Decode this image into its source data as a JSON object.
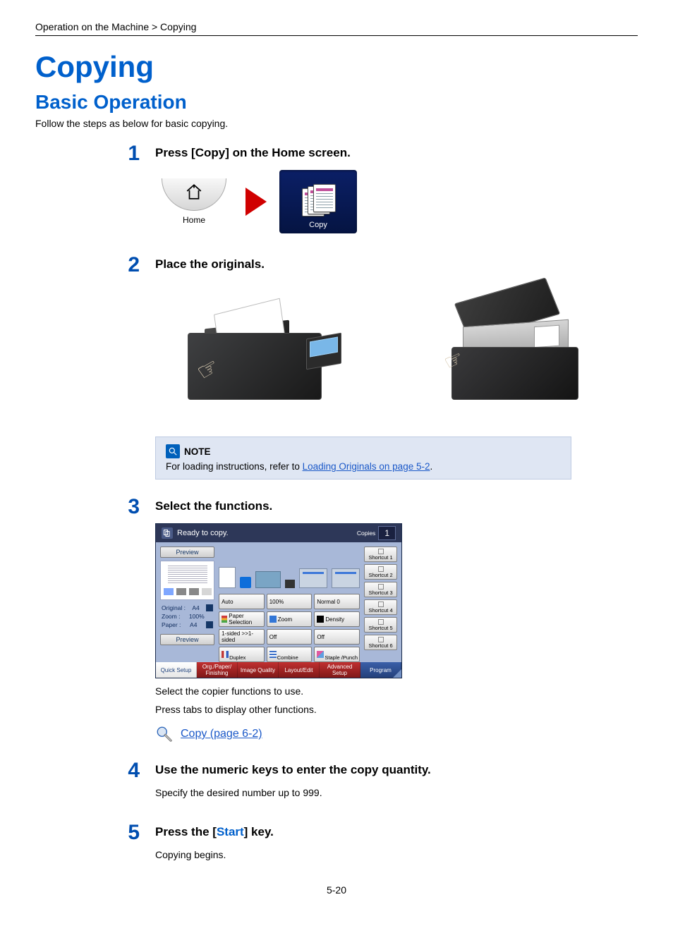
{
  "breadcrumb": "Operation on the Machine > Copying",
  "h1": "Copying",
  "h2": "Basic Operation",
  "intro": "Follow the steps as below for basic copying.",
  "steps": {
    "s1": {
      "num": "1",
      "title": "Press [Copy] on the Home screen.",
      "home_label": "Home",
      "copy_label": "Copy"
    },
    "s2": {
      "num": "2",
      "title": "Place the originals."
    },
    "note": {
      "label": "NOTE",
      "text_prefix": "For loading instructions, refer to ",
      "link": "Loading Originals on page 5-2",
      "text_suffix": "."
    },
    "s3": {
      "num": "3",
      "title": "Select the functions.",
      "text1": "Select the copier functions to use.",
      "text2": "Press tabs to display other functions.",
      "link": "Copy (page 6-2)"
    },
    "s4": {
      "num": "4",
      "title": "Use the numeric keys to enter the copy quantity.",
      "text": "Specify the desired number up to 999."
    },
    "s5": {
      "num": "5",
      "title_prefix": "Press the [",
      "title_start": "Start",
      "title_suffix": "] key.",
      "text": "Copying begins."
    }
  },
  "panel": {
    "status": "Ready to copy.",
    "copies_label": "Copies",
    "copies_value": "1",
    "left": {
      "preview_btn_top": "Preview",
      "info": {
        "original_label": "Original",
        "original_val": "A4",
        "zoom_label": "Zoom",
        "zoom_val": "100%",
        "paper_label": "Paper",
        "paper_val": "A4"
      },
      "preview_btn_bottom": "Preview"
    },
    "options": {
      "auto": "Auto",
      "pct": "100%",
      "normal": "Normal 0",
      "paper_sel": "Paper Selection",
      "zoom": "Zoom",
      "density": "Density",
      "onesided": "1-sided >>1-sided",
      "off1": "Off",
      "off2": "Off",
      "duplex": "Duplex",
      "combine": "Combine",
      "staple": "Staple /Punch"
    },
    "shortcuts": [
      "Shortcut 1",
      "Shortcut 2",
      "Shortcut 3",
      "Shortcut 4",
      "Shortcut 5",
      "Shortcut 6"
    ],
    "tabs": {
      "quick": "Quick Setup",
      "ofin": "Org./Paper/ Finishing",
      "iq": "Image Quality",
      "le": "Layout/Edit",
      "adv": "Advanced Setup",
      "prog": "Program"
    }
  },
  "page_number": "5-20"
}
